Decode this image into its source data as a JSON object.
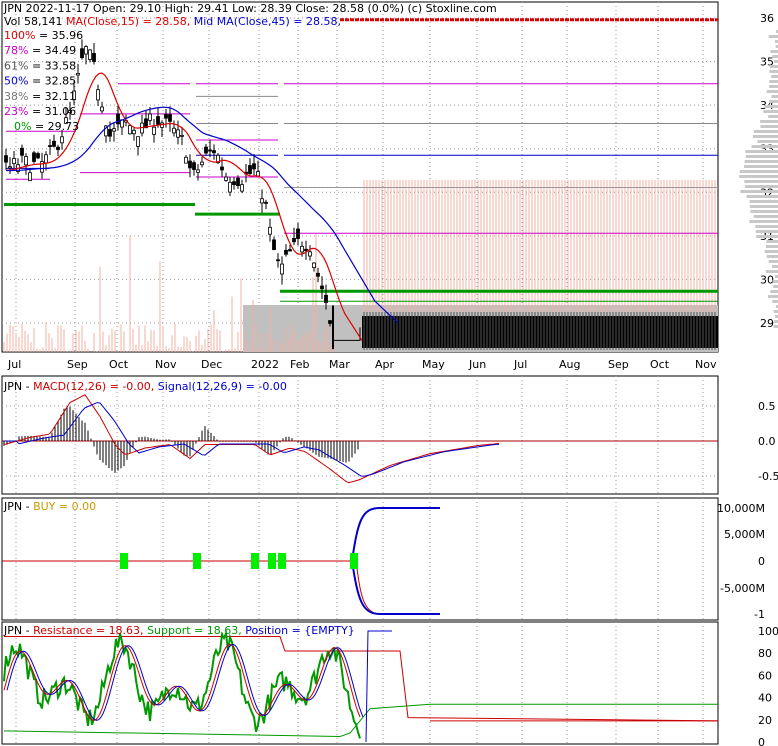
{
  "header": {
    "symbol": "JPN",
    "date": "2022-11-17",
    "open_label": "Open:",
    "open": "29.10",
    "high_label": "High:",
    "high": "29.41",
    "low_label": "Low:",
    "low": "28.39",
    "close_label": "Close:",
    "close": "28.58 (0.0%)",
    "source": "(c) Stoxline.com",
    "vol_label": "Vol",
    "vol": "58,141",
    "ma15_label": "MA(Close,15) = 28.58,",
    "ma45_label": "Mid MA(Close,45) = 28.58,"
  },
  "fib_levels": [
    {
      "pct": "100%",
      "value": "35.96",
      "color": "#dd0000"
    },
    {
      "pct": "78%",
      "value": "34.49",
      "color": "#cc00cc"
    },
    {
      "pct": "61%",
      "value": "33.58",
      "color": "#555555"
    },
    {
      "pct": "50%",
      "value": "32.85",
      "color": "#0000cc"
    },
    {
      "pct": "38%",
      "value": "32.11",
      "color": "#777777"
    },
    {
      "pct": "23%",
      "value": "31.06",
      "color": "#cc00cc"
    },
    {
      "pct": "0%",
      "value": "29.73",
      "color": "#009900"
    }
  ],
  "price_axis": [
    "36",
    "35",
    "34",
    "33",
    "32",
    "31",
    "30",
    "29"
  ],
  "months": [
    "Jul",
    "Sep",
    "Oct",
    "Nov",
    "Dec",
    "2022",
    "Feb",
    "Mar",
    "Apr",
    "May",
    "Jun",
    "Jul",
    "Aug",
    "Sep",
    "Oct",
    "Nov"
  ],
  "macd": {
    "symbol": "JPN",
    "label": "MACD(12,26) = -0.00,",
    "signal_label": "Signal(12,26,9) = -0.00",
    "axis": [
      "0.5",
      "0.0",
      "-0.5"
    ]
  },
  "buy": {
    "symbol": "JPN",
    "label": "BUY = 0.00",
    "axis": [
      "10,000M",
      "5,000M",
      "0",
      "-5,000M",
      "-1"
    ]
  },
  "position": {
    "symbol": "JPN",
    "resistance_label": "Resistance = 18.63,",
    "support_label": "Support = 18.63,",
    "position_label": "Position = {EMPTY}",
    "axis": [
      "100",
      "80",
      "60",
      "40",
      "20",
      "0"
    ]
  },
  "colors": {
    "ma15": "#dd0000",
    "ma45": "#0000cc",
    "support": "#009900",
    "macd": "#cc0000",
    "signal": "#0000cc",
    "buy_marker": "#00ee00",
    "volume": "#f0b0a0",
    "grey_zone": "#c0c0c0"
  },
  "chart_data": [
    {
      "type": "candlestick",
      "title": "JPN 2022-11-17",
      "ylim": [
        28.4,
        36.2
      ],
      "x_ticks": [
        "Jul",
        "Sep",
        "Oct",
        "Nov",
        "Dec",
        "2022",
        "Feb",
        "Mar",
        "Apr",
        "May",
        "Jun",
        "Jul",
        "Aug",
        "Sep",
        "Oct",
        "Nov"
      ],
      "y_ticks": [
        36,
        35,
        34,
        33,
        32,
        31,
        30,
        29
      ],
      "fibonacci": [
        35.96,
        34.49,
        33.58,
        32.85,
        32.11,
        31.06,
        29.73
      ],
      "last": {
        "open": 29.1,
        "high": 29.41,
        "low": 28.39,
        "close": 28.58
      },
      "grid": true
    },
    {
      "type": "line",
      "title": "MACD(12,26)",
      "ylim": [
        -0.75,
        0.8
      ],
      "y_ticks": [
        0.5,
        0.0,
        -0.5
      ],
      "macd_last": -0.0,
      "signal_last": -0.0
    },
    {
      "type": "line",
      "title": "BUY",
      "y_ticks": [
        "10,000M",
        "5,000M",
        "0",
        "-5,000M",
        "-1"
      ],
      "buy_last": 0.0
    },
    {
      "type": "line",
      "title": "Resistance / Support",
      "ylim": [
        0,
        100
      ],
      "y_ticks": [
        100,
        80,
        60,
        40,
        20,
        0
      ],
      "resistance": 18.63,
      "support": 18.63
    }
  ]
}
